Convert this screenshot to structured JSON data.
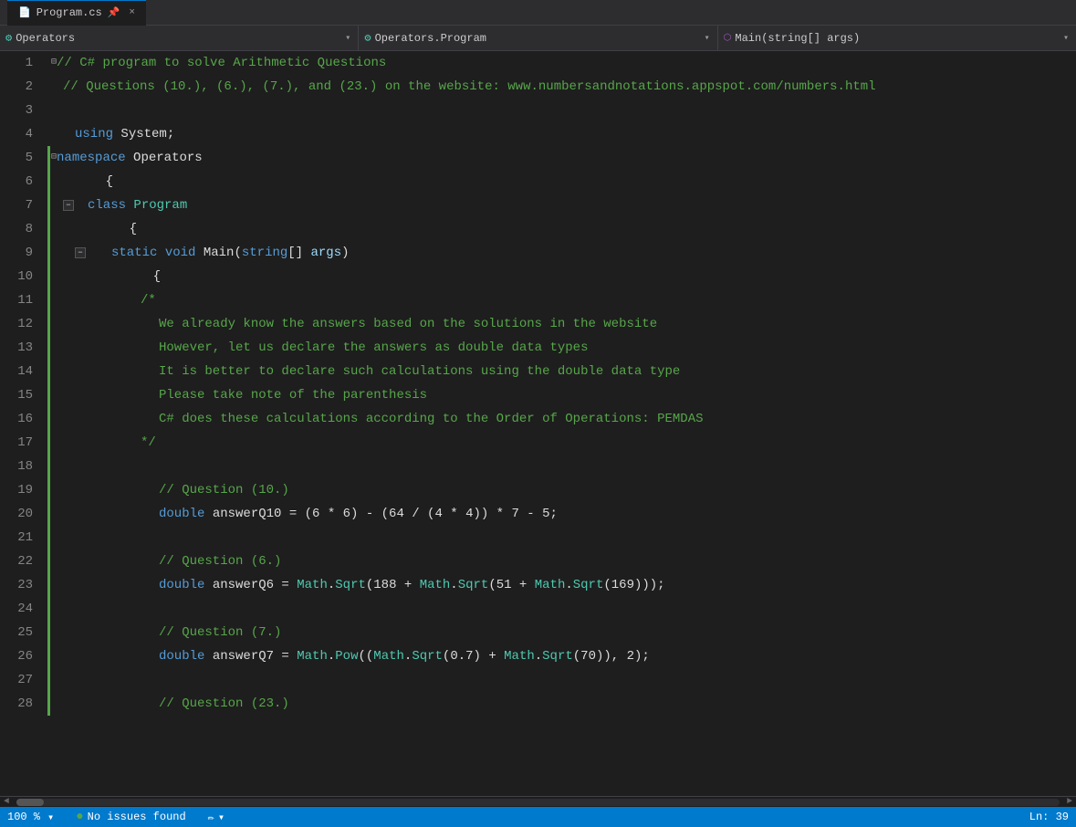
{
  "titlebar": {
    "tab_label": "Program.cs",
    "tab_close": "×"
  },
  "navbar": {
    "section1_icon": "⚙",
    "section1_text": "Operators",
    "section2_icon": "⚙",
    "section2_text": "Operators.Program",
    "section3_icon": "⬡",
    "section3_text": "Main(string[] args)"
  },
  "statusbar": {
    "zoom": "100 %",
    "issues_icon": "✓",
    "issues_text": "No issues found",
    "arrow_left": "◄",
    "arrow_right": "►",
    "ln": "Ln: 39"
  },
  "lines": [
    1,
    2,
    3,
    4,
    5,
    6,
    7,
    8,
    9,
    10,
    11,
    12,
    13,
    14,
    15,
    16,
    17,
    18,
    19,
    20,
    21,
    22,
    23,
    24,
    25,
    26,
    27,
    28
  ]
}
